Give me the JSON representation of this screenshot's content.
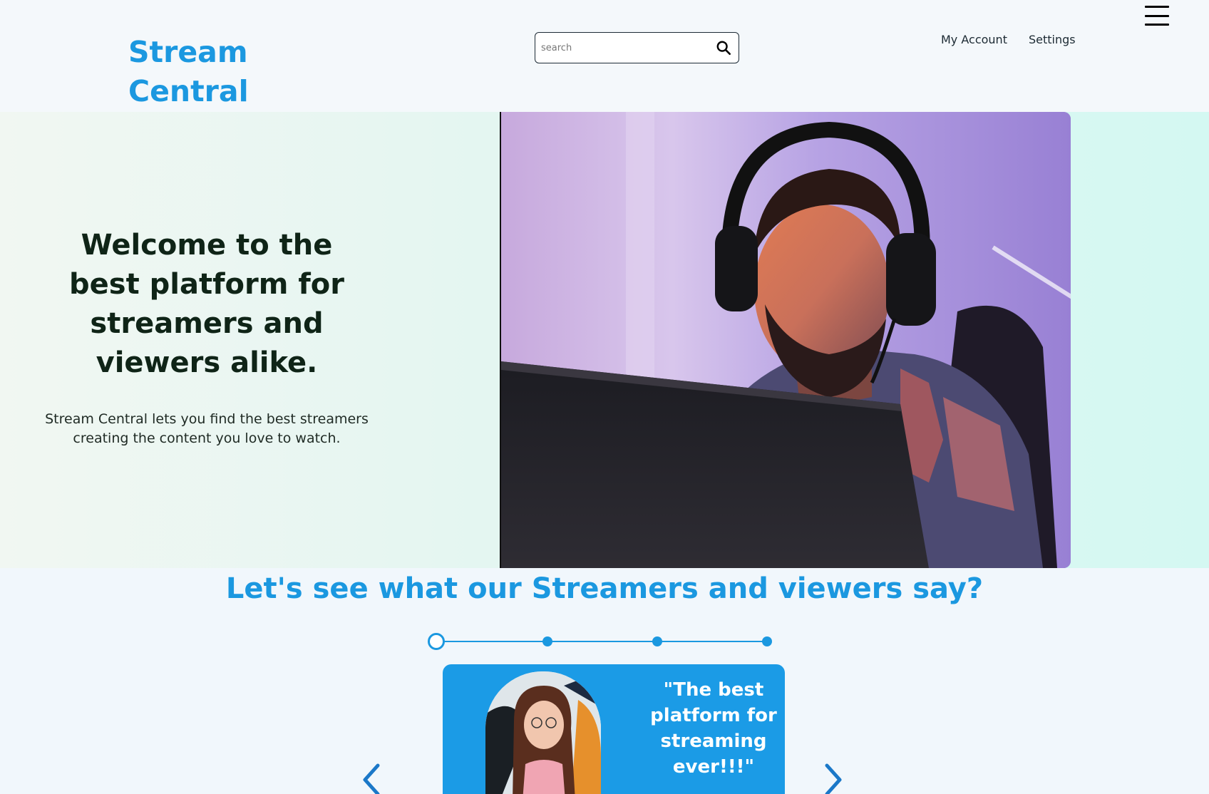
{
  "header": {
    "logo_line1": "Stream",
    "logo_line2": "Central",
    "search_placeholder": "search",
    "nav": [
      {
        "label": "My Account"
      },
      {
        "label": "Settings"
      }
    ]
  },
  "hero": {
    "title": "Welcome to the best platform for streamers and viewers alike.",
    "subtitle": "Stream Central lets you find the best streamers creating the content you love to watch."
  },
  "testimonials": {
    "title": "Let's see what our Streamers and viewers say?",
    "steps": 4,
    "active_step": 1,
    "quote": "\"The best platform for streaming ever!!!\""
  },
  "colors": {
    "accent": "#1b98e0",
    "card": "#1b9be6",
    "heading_dark": "#0f2417"
  }
}
